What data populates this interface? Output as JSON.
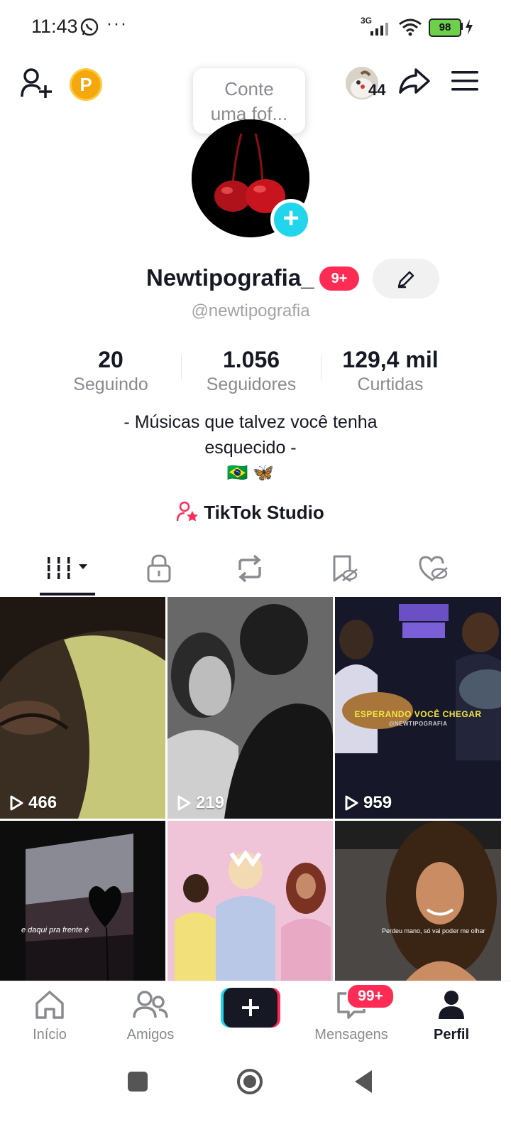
{
  "status_bar": {
    "time": "11:43",
    "network": "3G",
    "battery": "98"
  },
  "top_bar": {
    "tooltip_line1": "Conte",
    "tooltip_line2": "uma fof...",
    "follow_requests_count": "44"
  },
  "profile": {
    "display_name": "Newtipografia_",
    "badge": "9+",
    "handle": "@newtipografia",
    "stats": [
      {
        "value": "20",
        "label": "Seguindo"
      },
      {
        "value": "1.056",
        "label": "Seguidores"
      },
      {
        "value": "129,4 mil",
        "label": "Curtidas"
      }
    ],
    "bio_line1": "- Músicas que talvez você tenha",
    "bio_line2": "esquecido -",
    "bio_emojis": "🇧🇷 🦋",
    "studio_label": "TikTok Studio"
  },
  "tabs": [
    "videos-tab",
    "private-tab",
    "reposts-tab",
    "favorites-tab",
    "liked-tab"
  ],
  "videos": [
    {
      "views": "466"
    },
    {
      "views": "219"
    },
    {
      "views": "959",
      "caption": "ESPERANDO VOCÊ CHEGAR",
      "sub_caption": "@NEWTIPOGRAFIA"
    },
    {
      "views": "",
      "caption": "e daqui pra frente é"
    },
    {
      "views": ""
    },
    {
      "views": "",
      "caption": "Perdeu mano, só vai poder me olhar"
    }
  ],
  "bottom_nav": {
    "items": [
      {
        "label": "Início"
      },
      {
        "label": "Amigos"
      },
      {
        "label": "Mensagens",
        "badge": "99+"
      },
      {
        "label": "Perfil"
      }
    ]
  },
  "colors": {
    "accent": "#fe2c55",
    "cyan": "#20d5ec",
    "text": "#161823",
    "muted": "#8a8b91"
  }
}
